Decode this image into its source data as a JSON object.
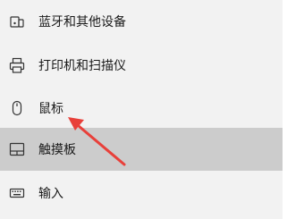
{
  "nav": {
    "items": [
      {
        "label": "蓝牙和其他设备",
        "icon": "bluetooth-devices-icon"
      },
      {
        "label": "打印机和扫描仪",
        "icon": "printer-icon"
      },
      {
        "label": "鼠标",
        "icon": "mouse-icon"
      },
      {
        "label": "触摸板",
        "icon": "touchpad-icon",
        "selected": true
      },
      {
        "label": "输入",
        "icon": "keyboard-icon"
      }
    ]
  },
  "annotation": {
    "arrow_color": "#e8403a"
  },
  "colors": {
    "background": "#f2f2f2",
    "selected_background": "#cccccc",
    "text": "#1a1a1a"
  }
}
